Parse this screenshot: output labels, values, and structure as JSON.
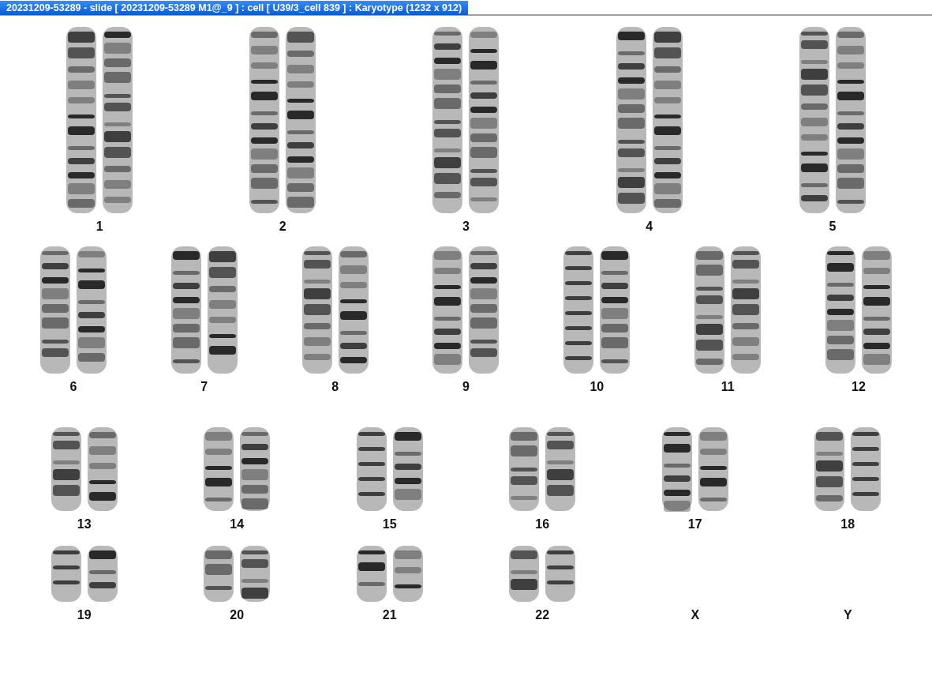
{
  "window": {
    "title": "20231209-53289 - slide [ 20231209-53289 M1@_9 ] : cell [ U39/3_cell 839 ] : Karyotype  (1232 x 912)"
  },
  "karyotype": {
    "rows": [
      {
        "groups": [
          {
            "label": "1",
            "kind": "pair"
          },
          {
            "label": "2",
            "kind": "pair"
          },
          {
            "label": "3",
            "kind": "pair"
          },
          {
            "label": "4",
            "kind": "pair"
          },
          {
            "label": "5",
            "kind": "pair"
          }
        ]
      },
      {
        "groups": [
          {
            "label": "6",
            "kind": "pair"
          },
          {
            "label": "7",
            "kind": "pair"
          },
          {
            "label": "8",
            "kind": "pair"
          },
          {
            "label": "9",
            "kind": "pair"
          },
          {
            "label": "10",
            "kind": "pair"
          },
          {
            "label": "11",
            "kind": "pair"
          },
          {
            "label": "12",
            "kind": "pair"
          }
        ]
      },
      {
        "groups": [
          {
            "label": "13",
            "kind": "pair"
          },
          {
            "label": "14",
            "kind": "pair"
          },
          {
            "label": "15",
            "kind": "pair"
          },
          {
            "label": "16",
            "kind": "pair"
          },
          {
            "label": "17",
            "kind": "pair"
          },
          {
            "label": "18",
            "kind": "pair"
          }
        ]
      },
      {
        "groups": [
          {
            "label": "19",
            "kind": "pair"
          },
          {
            "label": "20",
            "kind": "pair"
          },
          {
            "label": "21",
            "kind": "pair"
          },
          {
            "label": "22",
            "kind": "pair"
          },
          {
            "label": "X",
            "kind": "empty"
          },
          {
            "label": "Y",
            "kind": "empty"
          }
        ]
      }
    ]
  }
}
